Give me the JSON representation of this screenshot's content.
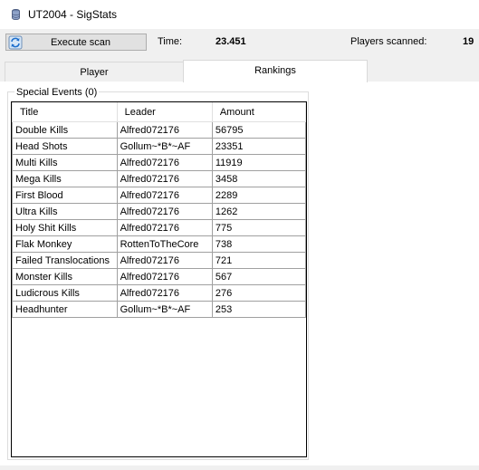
{
  "window": {
    "title": "UT2004 - SigStats"
  },
  "toolbar": {
    "execute_label": "Execute scan",
    "time_label": "Time:",
    "time_value": "23.451",
    "players_label": "Players scanned:",
    "players_value": "19"
  },
  "tabs": [
    {
      "label": "Player",
      "active": false
    },
    {
      "label": "Rankings",
      "active": true
    }
  ],
  "rankings": {
    "group_title": "Special Events (0)",
    "columns": [
      "Title",
      "Leader",
      "Amount"
    ],
    "rows": [
      [
        "Double Kills",
        "Alfred072176",
        "56795"
      ],
      [
        "Head Shots",
        "Gollum~*B*~AF",
        "23351"
      ],
      [
        "Multi Kills",
        "Alfred072176",
        "11919"
      ],
      [
        "Mega Kills",
        "Alfred072176",
        "3458"
      ],
      [
        "First Blood",
        "Alfred072176",
        "2289"
      ],
      [
        "Ultra Kills",
        "Alfred072176",
        "1262"
      ],
      [
        "Holy Shit Kills",
        "Alfred072176",
        "775"
      ],
      [
        "Flak Monkey",
        "RottenToTheCore",
        "738"
      ],
      [
        "Failed Translocations",
        "Alfred072176",
        "721"
      ],
      [
        "Monster Kills",
        "Alfred072176",
        "567"
      ],
      [
        "Ludicrous Kills",
        "Alfred072176",
        "276"
      ],
      [
        "Headhunter",
        "Gollum~*B*~AF",
        "253"
      ]
    ]
  },
  "colors": {
    "toolbar_bg": "#f0f0f0",
    "button_bg": "#e1e1e1",
    "accent": "#1e6fcc"
  },
  "icons": {
    "app": "database-icon",
    "execute": "refresh-icon"
  }
}
